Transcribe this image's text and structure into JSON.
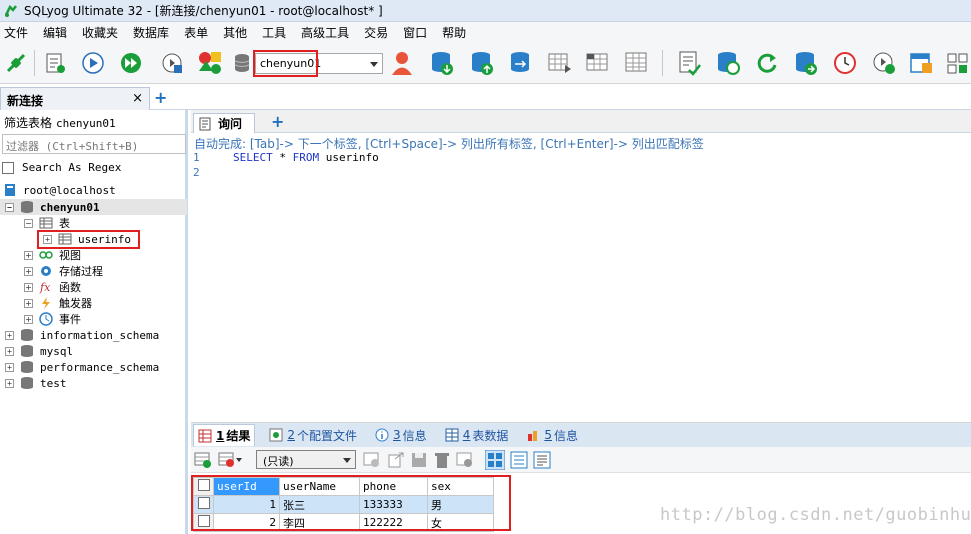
{
  "window": {
    "title": "SQLyog Ultimate 32 - [新连接/chenyun01 - root@localhost* ]"
  },
  "menu": [
    "文件",
    "编辑",
    "收藏夹",
    "数据库",
    "表单",
    "其他",
    "工具",
    "高级工具",
    "交易",
    "窗口",
    "帮助"
  ],
  "toolbar": {
    "database_select": "chenyun01"
  },
  "connection_tab": {
    "label": "新连接",
    "close": "×",
    "add": "+"
  },
  "filter": {
    "label": "筛选表格",
    "db": "chenyun01",
    "placeholder": "过滤器 (Ctrl+Shift+B)",
    "regex_label": "Search As Regex"
  },
  "tree": {
    "root": "root@localhost",
    "db": "chenyun01",
    "tables_folder": "表",
    "table": "userinfo",
    "views": "视图",
    "procs": "存储过程",
    "funcs": "函数",
    "triggers": "触发器",
    "events": "事件",
    "other_dbs": [
      "information_schema",
      "mysql",
      "performance_schema",
      "test"
    ]
  },
  "query_tab": {
    "label": "询问",
    "add": "+"
  },
  "editor": {
    "hint": "自动完成: [Tab]-> 下一个标签, [Ctrl+Space]-> 列出所有标签, [Ctrl+Enter]-> 列出匹配标签",
    "lines": [
      "1",
      "2"
    ],
    "kw_select": "SELECT",
    "star": "*",
    "kw_from": "FROM",
    "table": "userinfo"
  },
  "result_tabs": [
    {
      "num": "1",
      "label": "结果"
    },
    {
      "num": "2",
      "label": "个配置文件"
    },
    {
      "num": "3",
      "label": "信息"
    },
    {
      "num": "4",
      "label": "表数据"
    },
    {
      "num": "5",
      "label": "信息"
    }
  ],
  "result_toolbar": {
    "mode": "(只读)"
  },
  "grid": {
    "columns": [
      "userId",
      "userName",
      "phone",
      "sex"
    ],
    "rows": [
      [
        "1",
        "张三",
        "133333",
        "男"
      ],
      [
        "2",
        "李四",
        "122222",
        "女"
      ]
    ]
  },
  "watermark": "http://blog.csdn.net/guobinhui"
}
